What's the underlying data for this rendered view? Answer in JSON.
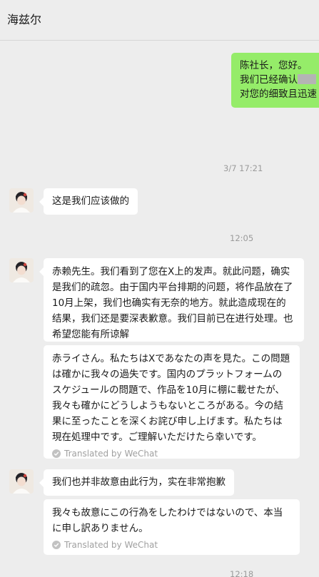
{
  "header": {
    "title": "海兹尔"
  },
  "messages": {
    "outgoing_1": {
      "line1": "陈社长，您好。",
      "line2": "我们已经确认",
      "line3": "对您的细致且迅速"
    },
    "time_1": "3/7 17:21",
    "incoming_1": "这是我们应该做的",
    "time_2": "12:05",
    "incoming_2": "赤赖先生。我们看到了您在X上的发声。就此问题，确实是我们的疏忽。由于国内平台排期的问题，将作品放在了10月上架，我们也确实有无奈的地方。就此造成现在的结果，我们还是要深表歉意。我们目前已在进行处理。也希望您能有所谅解",
    "translation_2": "赤ライさん。私たちはXであなたの声を見た。この問題は確かに我々の過失です。国内のプラットフォームのスケジュールの問題で、作品を10月に棚に載せたが、我々も確かにどうしようもないところがある。今の結果に至ったことを深くお詫び申し上げます。私たちは現在処理中です。ご理解いただけたら幸いです。",
    "incoming_3": "我们也并非故意由此行为，实在非常抱歉",
    "translation_3": "我々も故意にこの行為をしたわけではないので、本当に申し訳ありません。",
    "translated_label": "Translated by WeChat",
    "time_3": "12:18"
  },
  "icons": {
    "translated": "check-circle-icon",
    "avatar": "contact-avatar"
  },
  "colors": {
    "outgoing_bubble": "#95ec69",
    "incoming_bubble": "#ffffff",
    "background": "#ededed"
  }
}
